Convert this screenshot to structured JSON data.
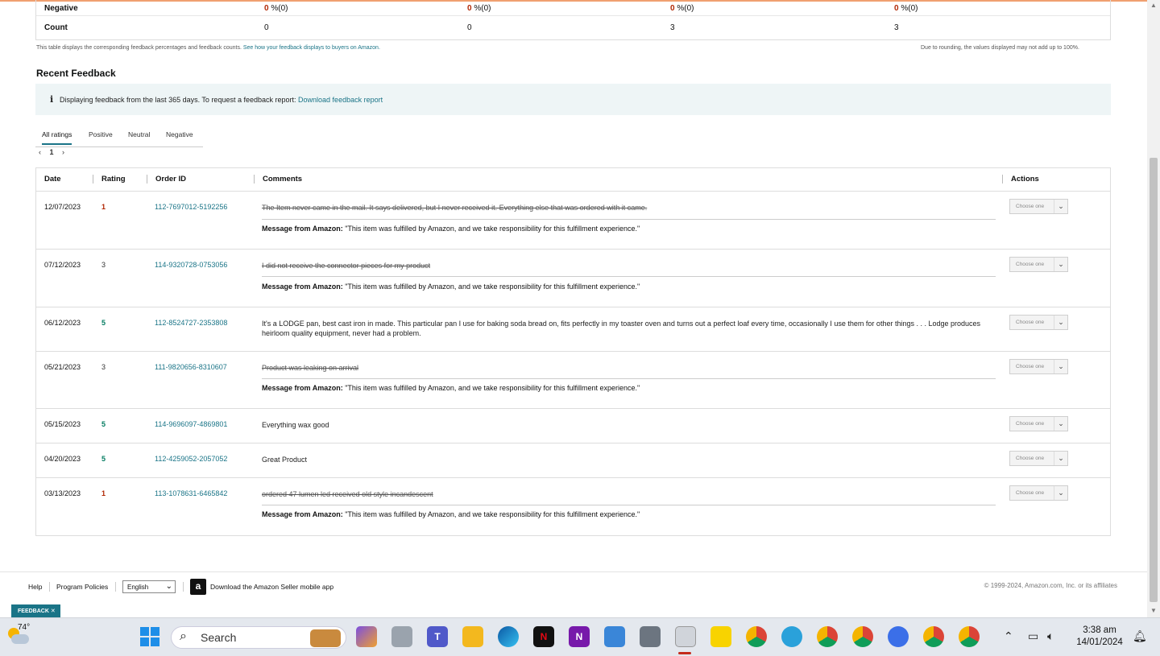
{
  "summary": {
    "negative_label": "Negative",
    "negative_values": [
      {
        "num": "0",
        "rest": " %(0)"
      },
      {
        "num": "0",
        "rest": " %(0)"
      },
      {
        "num": "0",
        "rest": " %(0)"
      },
      {
        "num": "0",
        "rest": " %(0)"
      }
    ],
    "count_label": "Count",
    "count_values": [
      "0",
      "0",
      "3",
      "3"
    ],
    "note_left": "This table displays the corresponding feedback percentages and feedback counts.",
    "note_link": "See how your feedback displays to buyers on Amazon.",
    "note_right": "Due to rounding, the values displayed may not add up to 100%."
  },
  "recent": {
    "title": "Recent Feedback",
    "info_icon": "i",
    "info_text": "Displaying feedback from the last 365 days. To request a feedback report:",
    "info_link": "Download feedback report"
  },
  "tabs": [
    "All ratings",
    "Positive",
    "Neutral",
    "Negative"
  ],
  "pager": {
    "prev": "‹",
    "page": "1",
    "next": "›"
  },
  "table": {
    "headers": {
      "date": "Date",
      "rating": "Rating",
      "order": "Order ID",
      "comments": "Comments",
      "actions": "Actions"
    },
    "action_placeholder": "Choose one",
    "message_label": "Message from Amazon:",
    "message_text": " \"This item was fulfilled by Amazon, and we take responsibility for this fulfillment experience.\"",
    "rows": [
      {
        "date": "12/07/2023",
        "rating": "1",
        "order": "112-7697012-5192256",
        "comment": "The Item never came in the mail. It says delivered, but I never received it. Everything else that was ordered with it came."
      },
      {
        "date": "07/12/2023",
        "rating": "3",
        "order": "114-9320728-0753056",
        "comment": "I did not receive the connector pieces for my product"
      },
      {
        "date": "06/12/2023",
        "rating": "5",
        "order": "112-8524727-2353808",
        "comment": "It's a LODGE pan, best cast iron in made. This particular pan I use for baking soda bread on, fits perfectly in my toaster oven and turns out a perfect loaf every time, occasionally I use them for other things . . . Lodge produces heirloom quality equipment, never had a problem."
      },
      {
        "date": "05/21/2023",
        "rating": "3",
        "order": "111-9820656-8310607",
        "comment": "Product was leaking on arrival"
      },
      {
        "date": "05/15/2023",
        "rating": "5",
        "order": "114-9696097-4869801",
        "comment": "Everything wax good"
      },
      {
        "date": "04/20/2023",
        "rating": "5",
        "order": "112-4259052-2057052",
        "comment": "Great Product"
      },
      {
        "date": "03/13/2023",
        "rating": "1",
        "order": "113-1078631-6465842",
        "comment": "ordered 47 lumen led received old style incandescent"
      }
    ]
  },
  "footer": {
    "help": "Help",
    "policies": "Program Policies",
    "language": "English",
    "app_icon": "a",
    "app_text": "Download the Amazon Seller mobile app",
    "copyright": "© 1999-2024, Amazon.com, Inc. or its affiliates",
    "feedback_btn": "FEEDBACK ✕"
  },
  "taskbar": {
    "temp": "74°",
    "search": "Search",
    "time": "3:38 am",
    "date": "14/01/2024"
  },
  "colors": {
    "accent": "#1a7487",
    "negative": "#b12704",
    "positive": "#067d62"
  }
}
